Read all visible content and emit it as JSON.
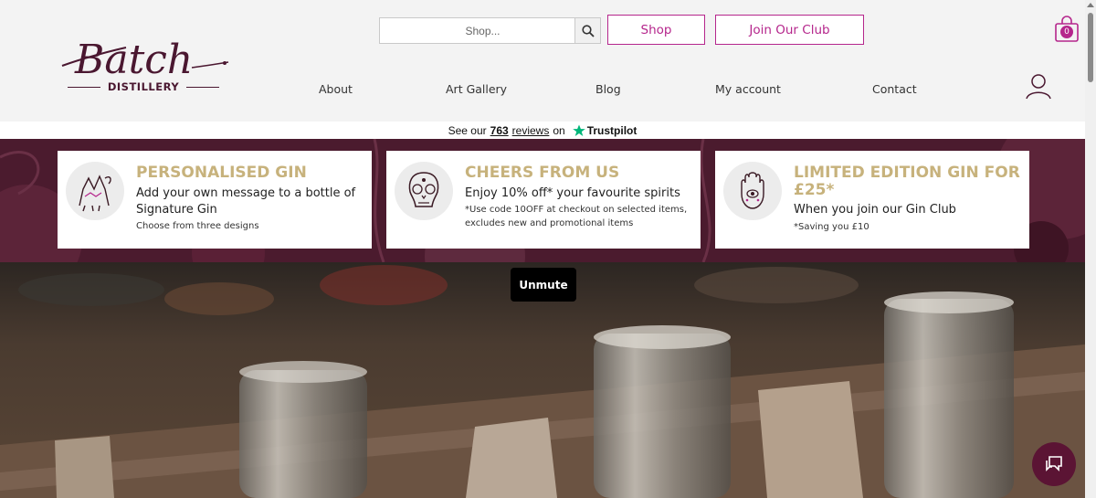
{
  "header": {
    "logo_script": "Batch",
    "logo_sub": "DISTILLERY",
    "search_placeholder": "Shop...",
    "shop_button": "Shop",
    "club_button": "Join Our Club",
    "cart_count": "0",
    "nav": [
      "About",
      "Art Gallery",
      "Blog",
      "My account",
      "Contact"
    ]
  },
  "trustpilot": {
    "prefix": "See our",
    "count": "763",
    "reviews": "reviews",
    "on": "on",
    "brand": "Trustpilot"
  },
  "promos": [
    {
      "icon": "camel-icon",
      "title": "PERSONALISED GIN",
      "body": "Add your own message to a bottle of Signature Gin",
      "small": "Choose from three designs"
    },
    {
      "icon": "sugar-skull-icon",
      "title": "CHEERS FROM US",
      "body": "Enjoy 10% off* your favourite spirits",
      "small": "*Use code 10OFF at checkout on selected items, excludes new and promotional items"
    },
    {
      "icon": "hamsa-hand-icon",
      "title": "LIMITED EDITION GIN FOR £25*",
      "body": "When you join our Gin Club",
      "small": "*Saving you £10"
    }
  ],
  "video": {
    "unmute_label": "Unmute"
  },
  "colors": {
    "accent": "#b5268c",
    "brand_dark": "#4a1730",
    "gold": "#c7b27c",
    "promo_bg": "#4b1b2e",
    "trust_green": "#00b67a"
  }
}
